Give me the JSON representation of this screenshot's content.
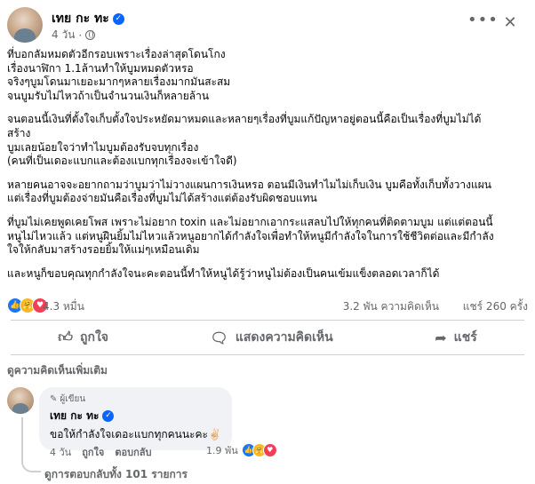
{
  "post": {
    "author": "เทย กะ ทะ",
    "time": "4 วัน",
    "paragraphs": [
      [
        "ที่บอกลัมหมดตัวอีกรอบเพราะเรื่องล่าสุดโดนโกง",
        "เรื่องนาฬิกา 1.1ล้านทำให้บูมหมดตัวหรอ",
        "จริงๆบูมโดนมาเยอะมากๆหลายเรื่องมากมันสะสม",
        "จนบูมรับไม่ไหวถ้าเป็นจำนวนเงินก็หลายล้าน"
      ],
      [
        "จนตอนนี้เงินที่ตั้งใจเก็บตั้งใจประหยัดมาหมดและหลายๆเรื่องที่บูมแก้ปัญหาอยู่ตอนนี้คือเป็นเรื่องที่บูมไม่ได้",
        "สร้าง",
        "บูมเลยน้อยใจว่าทำไมบูมต้องรับจบทุกเรื่อง",
        "(คนที่เป็นเดอะแบกและต้องแบกทุกเรื่องจะเข้าใจดี)"
      ],
      [
        "หลายคนอาจจะอยากถามว่าบูมว่าไม่วางแผนการเงินหรอ ตอนมีเงินทำไมไม่เก็บเงิน บูมคือทั้งเก็บทั้งวางแผน",
        "แต่เรื่องที่บูมต้องจ่ายมันคือเรื่องที่บูมไม่ได้สร้างแต่ต้องรับผิดชอบแทน"
      ],
      [
        "ที่บูมไม่เคยพูดเคยโพส เพราะไม่อยาก  toxin และไม่อยากเอากระแสลบไปให้ทุกคนที่ติดตามบูม แต่แต่ตอนนี้",
        "หนูไม่ไหวแล้ว แต่หนูฝืนยิ้มไม่ไหวแล้วหนูอยากได้กำลังใจเพื่อทำให้หนูมีกำลังใจในการใช้ชีวิตต่อและมีกำลัง",
        "ใจให้กลับมาสร้างรอยยิ้มให้แม่ๆเหมือนเดิม"
      ],
      [
        "และหนูก็ขอบคุณทุกกำลังใจนะคะตอนนี้ทำให้หนูได้รู้ว่าหนูไม่ต้องเป็นคนเข้มแข็งตลอดเวลาก็ได้"
      ]
    ]
  },
  "stats": {
    "reactions": "4.3 หมื่น",
    "comments": "3.2 พัน ความคิดเห็น",
    "shares": "แชร์ 260 ครั้ง"
  },
  "actions": {
    "like": "ถูกใจ",
    "comment": "แสดงความคิดเห็น",
    "share": "แชร์"
  },
  "comments_section": {
    "more_label": "ดูความคิดเห็นเพิ่มเติม",
    "comment": {
      "badge": "ผู้เขียน",
      "author": "เทย กะ ทะ",
      "text": "ขอให้กำลังใจเดอะแบกทุกคนนะคะ✌🏻",
      "time": "4 วัน",
      "like_label": "ถูกใจ",
      "reply_label": "ตอบกลับ",
      "reaction_count": "1.9 พัน"
    },
    "view_replies": "ดูการตอบกลับทั้ง 101 รายการ"
  },
  "colors": {
    "verified": "#0866ff",
    "like": "#1877f2",
    "care": "#f7b928",
    "love": "#f33e58",
    "secondary_text": "#65676b"
  }
}
